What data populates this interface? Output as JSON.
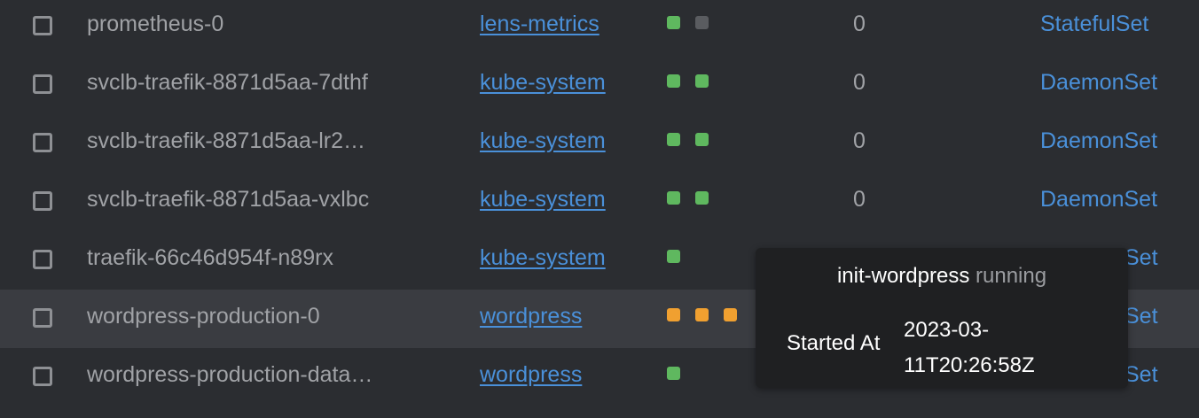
{
  "colors": {
    "background": "#2b2d31",
    "row_highlight": "#3a3c41",
    "link": "#4a90d9",
    "status_running": "#5fb85f",
    "status_waiting": "#f0a030",
    "status_unknown": "#5a5c60",
    "tooltip_bg": "#1f2022"
  },
  "rows": [
    {
      "name": "prometheus-0",
      "namespace": "lens-metrics",
      "containers": [
        "running",
        "unknown"
      ],
      "restarts": "0",
      "owner": "StatefulSet"
    },
    {
      "name": "svclb-traefik-8871d5aa-7dthf",
      "namespace": "kube-system",
      "containers": [
        "running",
        "running"
      ],
      "restarts": "0",
      "owner": "DaemonSet"
    },
    {
      "name": "svclb-traefik-8871d5aa-lr2…",
      "namespace": "kube-system",
      "containers": [
        "running",
        "running"
      ],
      "restarts": "0",
      "owner": "DaemonSet"
    },
    {
      "name": "svclb-traefik-8871d5aa-vxlbc",
      "namespace": "kube-system",
      "containers": [
        "running",
        "running"
      ],
      "restarts": "0",
      "owner": "DaemonSet"
    },
    {
      "name": "traefik-66c46d954f-n89rx",
      "namespace": "kube-system",
      "containers": [
        "running"
      ],
      "restarts": "",
      "owner": "Set"
    },
    {
      "name": "wordpress-production-0",
      "namespace": "wordpress",
      "containers": [
        "waiting",
        "waiting",
        "waiting"
      ],
      "restarts": "",
      "owner": "Set"
    },
    {
      "name": "wordpress-production-data…",
      "namespace": "wordpress",
      "containers": [
        "running"
      ],
      "restarts": "",
      "owner": "Set"
    }
  ],
  "highlighted_row": 5,
  "tooltip": {
    "container_name": "init-wordpress",
    "state": "running",
    "started_label": "Started At",
    "started_value": "2023-03-11T20:26:58Z",
    "started_value_line1": "2023-03-",
    "started_value_line2": "11T20:26:58Z"
  }
}
